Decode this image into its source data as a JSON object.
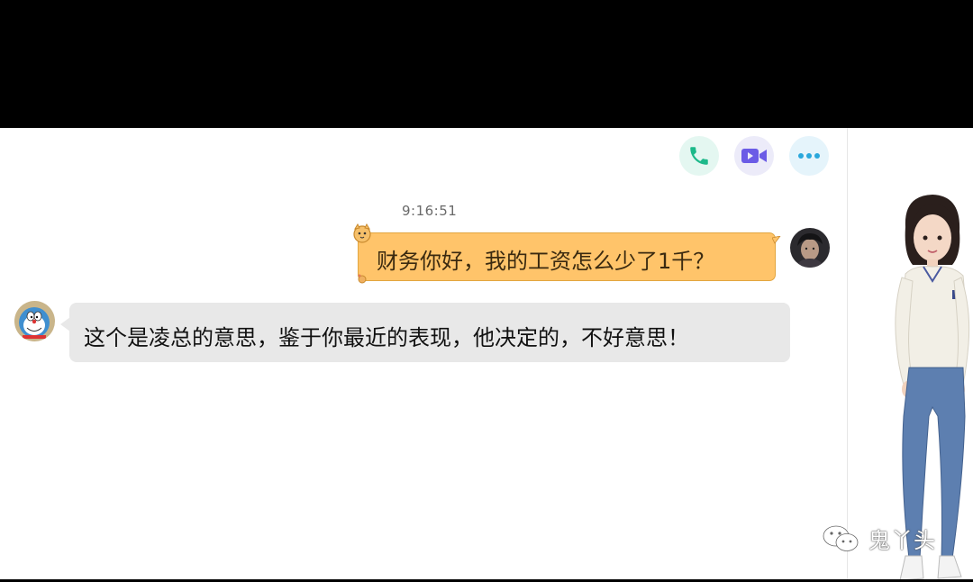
{
  "toolbar": {
    "call_icon": "phone-icon",
    "video_icon": "video-camera-icon",
    "more_icon": "more-dots-icon",
    "colors": {
      "call": "#1db98a",
      "video": "#6b5be6",
      "more": "#2aa8dc"
    }
  },
  "conversation": {
    "timestamp": "9:16:51",
    "messages": [
      {
        "sender": "me",
        "text": "财务你好，我的工资怎么少了1千？",
        "bubble_color": "#ffc46a"
      },
      {
        "sender": "other",
        "text": "这个是凌总的意思，鉴于你最近的表现，他决定的，不好意思！",
        "bubble_color": "#e8e8e8"
      }
    ]
  },
  "watermark": {
    "icon": "wechat-icon",
    "text": "鬼丫头"
  }
}
